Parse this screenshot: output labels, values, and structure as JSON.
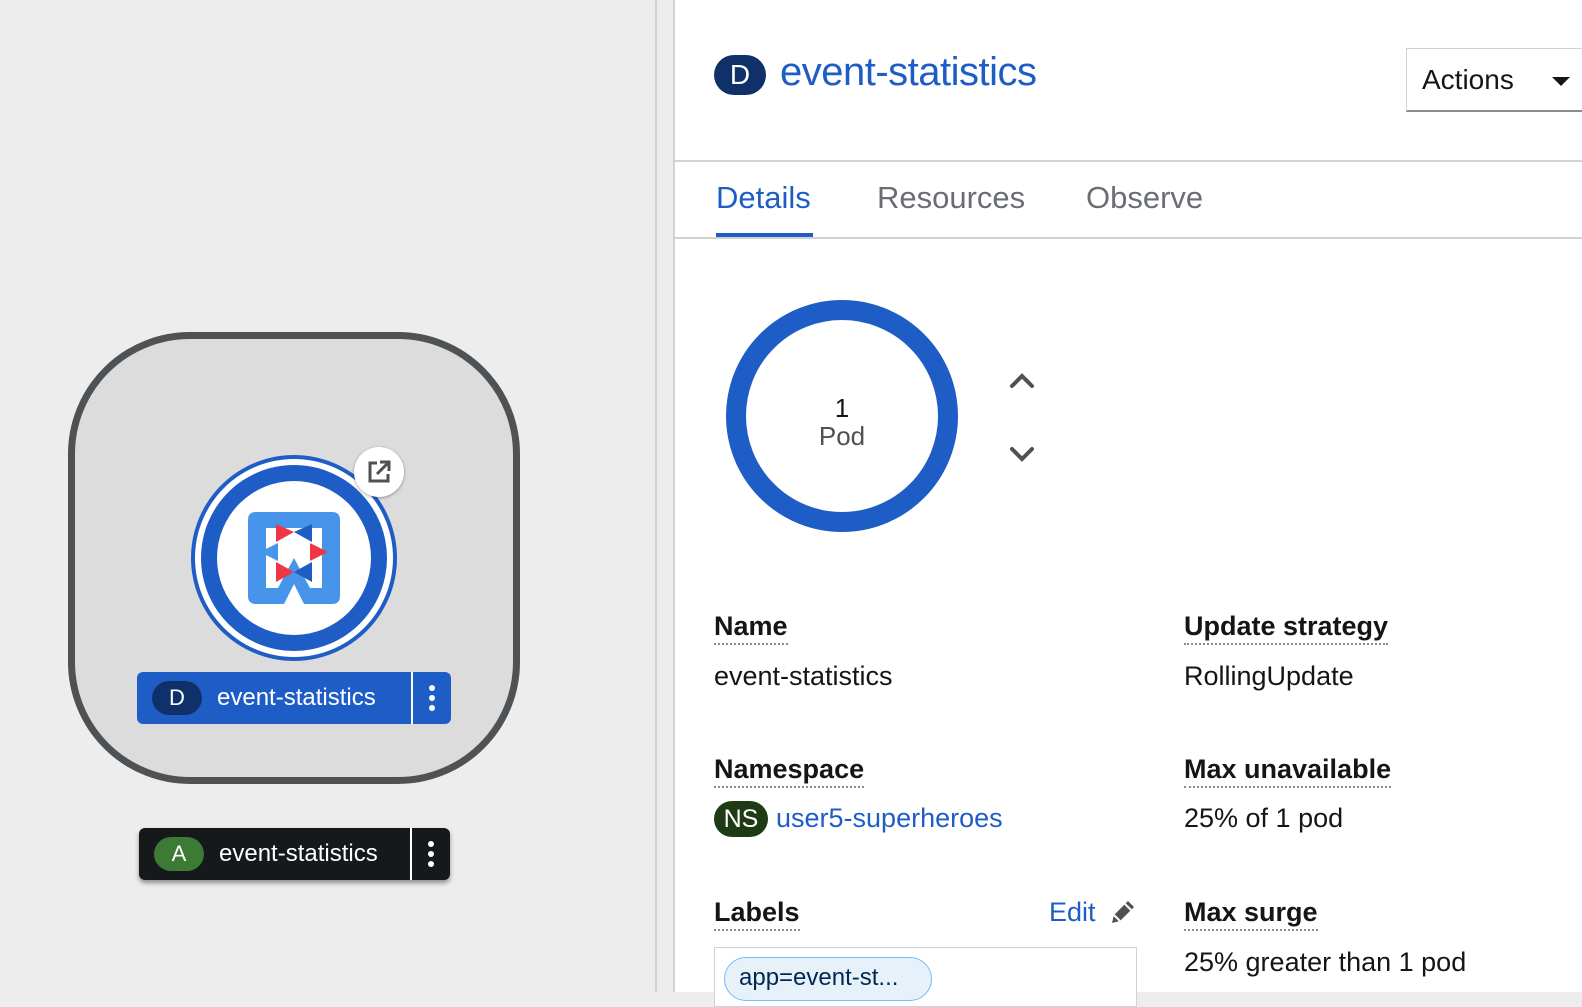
{
  "topology": {
    "deployment_node": {
      "kind_badge": "D",
      "name": "event-statistics",
      "icon": "quarkus-icon",
      "decorator_icon": "external-link-icon"
    },
    "application_group": {
      "kind_badge": "A",
      "name": "event-statistics"
    }
  },
  "panel": {
    "resource_badge": "D",
    "title": "event-statistics",
    "actions_label": "Actions",
    "tabs": [
      {
        "label": "Details",
        "active": true
      },
      {
        "label": "Resources",
        "active": false
      },
      {
        "label": "Observe",
        "active": false
      }
    ],
    "pods": {
      "count": "1",
      "unit": "Pod"
    },
    "details": {
      "name_label": "Name",
      "name_value": "event-statistics",
      "namespace_label": "Namespace",
      "namespace_badge": "NS",
      "namespace_value": "user5-superheroes",
      "labels_label": "Labels",
      "labels_edit": "Edit",
      "label_chip": "app=event-st..."
    },
    "strategy": {
      "update_strategy_label": "Update strategy",
      "update_strategy_value": "RollingUpdate",
      "max_unavailable_label": "Max unavailable",
      "max_unavailable_value": "25% of 1 pod",
      "max_surge_label": "Max surge",
      "max_surge_value": "25% greater than 1 pod"
    }
  },
  "colors": {
    "accent": "#1f5dc6",
    "deployment_badge": "#10306a",
    "app_badge": "#3d7a33",
    "namespace_badge": "#1f3b16"
  }
}
